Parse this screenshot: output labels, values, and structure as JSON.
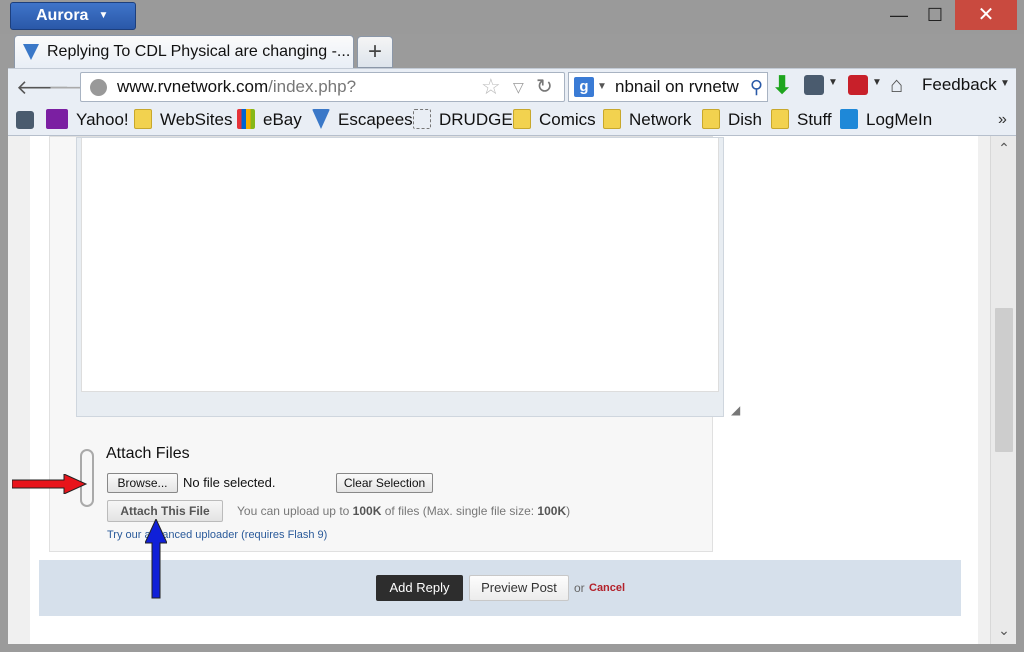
{
  "app": {
    "menu_label": "Aurora"
  },
  "window": {
    "minimize": "—",
    "maximize": "☐",
    "close": "✕"
  },
  "tab": {
    "title": "Replying To CDL Physical are changing -...",
    "new_tab": "+"
  },
  "nav": {
    "back": "🡐",
    "forward": "🡒",
    "url_host": "www.rvnetwork.com",
    "url_path": "/index.php?",
    "search_text": "nbnail on rvnetw",
    "search_engine_icon": "g",
    "feedback_label": "Feedback"
  },
  "bookmarks": [
    {
      "label": "Yahoo!",
      "icon": "yahoo-icon"
    },
    {
      "label": "WebSites",
      "icon": "folder-icon"
    },
    {
      "label": "eBay",
      "icon": "ebay-icon"
    },
    {
      "label": "Escapees",
      "icon": "escapees-icon"
    },
    {
      "label": "DRUDGE",
      "icon": "drudge-icon"
    },
    {
      "label": "Comics",
      "icon": "folder-icon"
    },
    {
      "label": "Network",
      "icon": "folder-icon"
    },
    {
      "label": "Dish",
      "icon": "folder-icon"
    },
    {
      "label": "Stuff",
      "icon": "folder-icon"
    },
    {
      "label": "LogMeIn",
      "icon": "logmein-icon"
    }
  ],
  "attach": {
    "title": "Attach Files",
    "browse_label": "Browse...",
    "no_file_text": "No file selected.",
    "clear_label": "Clear Selection",
    "attach_label": "Attach This File",
    "info_prefix": "You can upload up to ",
    "info_limit": "100K",
    "info_middle": " of files (Max. single file size: ",
    "info_single": "100K",
    "info_suffix": ")",
    "advanced_link": "Try our advanced uploader (requires Flash 9)"
  },
  "footer": {
    "add_reply": "Add Reply",
    "preview": "Preview Post",
    "or": "or",
    "cancel": "Cancel"
  },
  "colors": {
    "red_arrow": "#e8141b",
    "blue_arrow": "#1020d8",
    "app_button": "#2f62b7",
    "close_button": "#c94a3f"
  }
}
